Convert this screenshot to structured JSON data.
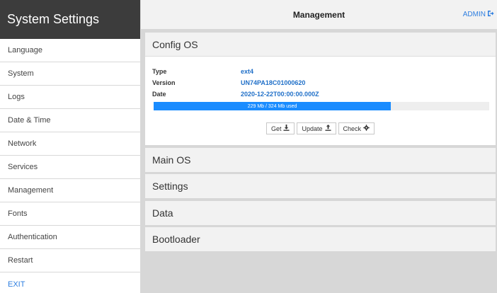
{
  "sidebar": {
    "title": "System Settings",
    "items": [
      {
        "label": "Language"
      },
      {
        "label": "System"
      },
      {
        "label": "Logs"
      },
      {
        "label": "Date & Time"
      },
      {
        "label": "Network"
      },
      {
        "label": "Services"
      },
      {
        "label": "Management"
      },
      {
        "label": "Fonts"
      },
      {
        "label": "Authentication"
      },
      {
        "label": "Restart"
      }
    ],
    "exit_label": "EXIT"
  },
  "header": {
    "title": "Management",
    "user_label": "ADMIN",
    "user_icon": "logout-icon"
  },
  "config_os": {
    "title": "Config OS",
    "type_label": "Type",
    "type_value": "ext4",
    "version_label": "Version",
    "version_value": "UN74PA18C01000620",
    "date_label": "Date",
    "date_value": "2020-12-22T00:00:00.000Z",
    "usage_text": "229 Mb / 324 Mb used",
    "usage_fraction": 0.707,
    "buttons": {
      "get_label": "Get",
      "update_label": "Update",
      "check_label": "Check"
    }
  },
  "panels": [
    {
      "title": "Main OS"
    },
    {
      "title": "Settings"
    },
    {
      "title": "Data"
    },
    {
      "title": "Bootloader"
    }
  ],
  "colors": {
    "accent": "#2f7fe0",
    "progress": "#1a8cff",
    "sidebar_header": "#3c3c3c"
  }
}
